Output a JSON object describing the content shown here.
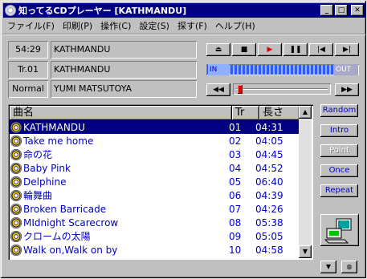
{
  "window": {
    "title": "知ってるCDプレーヤー [KATHMANDU]"
  },
  "menu": [
    "ファイル(F)",
    "印刷(P)",
    "操作(C)",
    "設定(S)",
    "探す(F)",
    "ヘルプ(H)"
  ],
  "info": {
    "time": "54:29",
    "album": "KATHMANDU",
    "track": "Tr.01",
    "track_title": "KATHMANDU",
    "mode": "Normal",
    "artist": "YUMI MATSUTOYA"
  },
  "volume": {
    "in_label": "IN",
    "out_label": "OUT"
  },
  "seek": {
    "position_fraction": 0.02
  },
  "list": {
    "headers": {
      "title": "曲名",
      "track": "Tr",
      "length": "長さ"
    },
    "rows": [
      {
        "title": "KATHMANDU",
        "tr": "01",
        "len": "04:31",
        "selected": true
      },
      {
        "title": "Take me home",
        "tr": "02",
        "len": "04:05"
      },
      {
        "title": "命の花",
        "tr": "03",
        "len": "04:45"
      },
      {
        "title": "Baby Pink",
        "tr": "04",
        "len": "04:52"
      },
      {
        "title": "Delphine",
        "tr": "05",
        "len": "06:40"
      },
      {
        "title": "輪舞曲",
        "tr": "06",
        "len": "04:39"
      },
      {
        "title": "Broken Barricade",
        "tr": "07",
        "len": "04:26"
      },
      {
        "title": "MIdnight Scarecrow",
        "tr": "08",
        "len": "05:38"
      },
      {
        "title": "クロームの太陽",
        "tr": "09",
        "len": "05:05"
      },
      {
        "title": "Walk on,Walk on by",
        "tr": "10",
        "len": "04:58"
      }
    ]
  },
  "side_buttons": {
    "random": "Random",
    "intro": "Intro",
    "point": "Point",
    "once": "Once",
    "repeat": "Repeat"
  },
  "colors": {
    "accent": "#000080",
    "link": "#0000c8"
  }
}
